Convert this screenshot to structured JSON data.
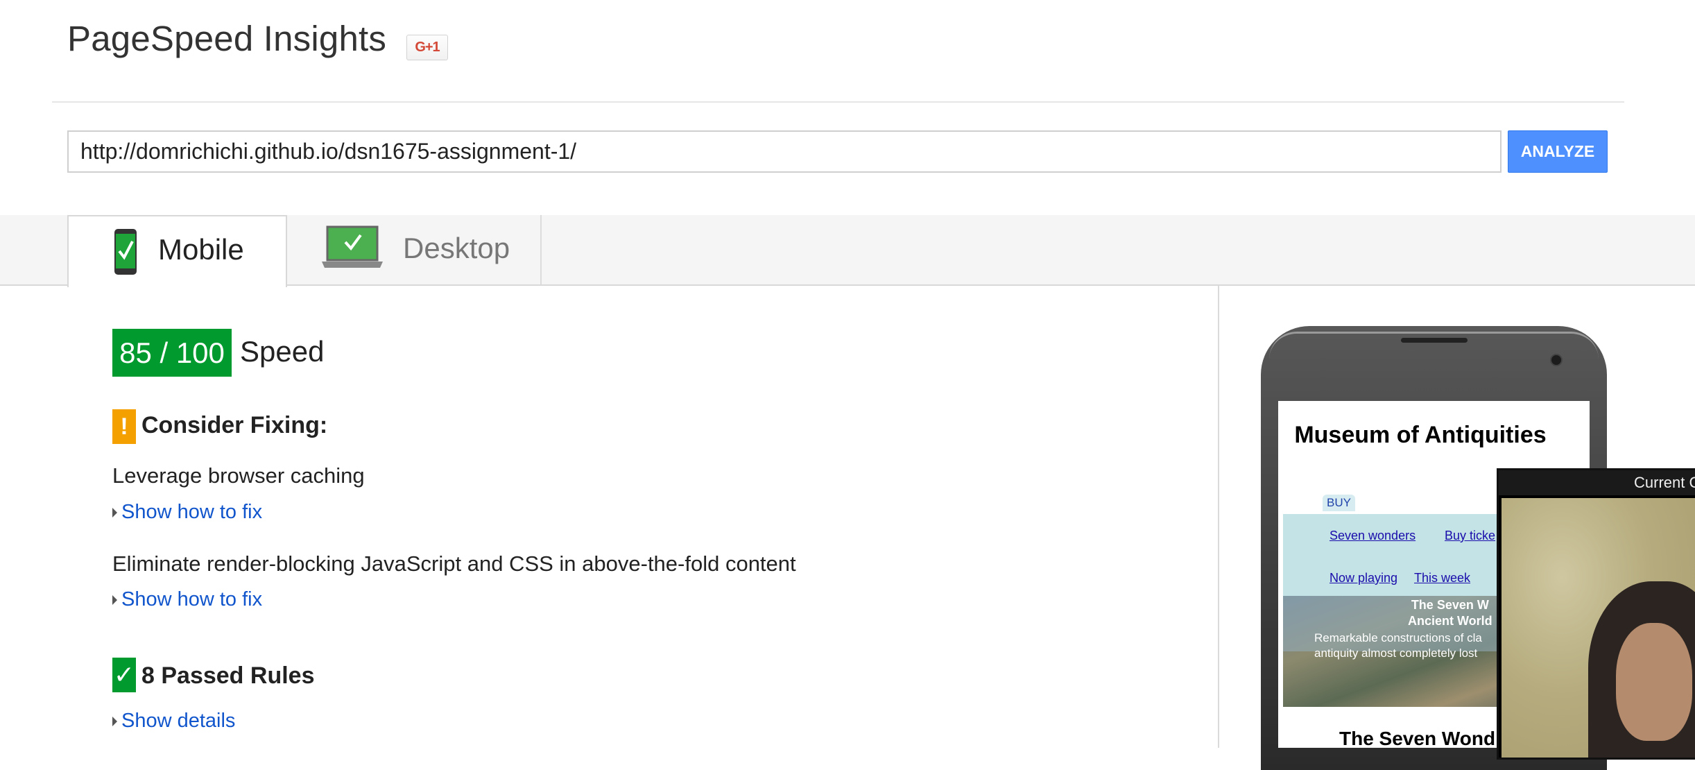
{
  "header": {
    "title": "PageSpeed Insights",
    "gplus_label": "G+1"
  },
  "search": {
    "url_value": "http://domrichichi.github.io/dsn1675-assignment-1/",
    "analyze_label": "ANALYZE"
  },
  "tabs": [
    {
      "label": "Mobile",
      "icon": "phone-check-icon",
      "active": true
    },
    {
      "label": "Desktop",
      "icon": "laptop-check-icon",
      "active": false
    }
  ],
  "score": {
    "value": "85 / 100",
    "label": "Speed",
    "color": "#009a2e"
  },
  "consider_fixing": {
    "heading": "Consider Fixing:",
    "icon": "warning-icon",
    "color": "#f4a100",
    "rules": [
      {
        "title": "Leverage browser caching",
        "link": "Show how to fix"
      },
      {
        "title": "Eliminate render-blocking JavaScript and CSS in above-the-fold content",
        "link": "Show how to fix"
      }
    ]
  },
  "passed": {
    "heading": "8 Passed Rules",
    "icon": "check-icon",
    "link": "Show details"
  },
  "preview": {
    "site_title": "Museum of Antiquities",
    "buy_tag": "BUY",
    "nav": [
      "Seven wonders",
      "Buy ticke",
      "Now playing",
      "This week"
    ],
    "hero_title": "The Seven W…\nAncient World",
    "hero_title_line1": "The Seven W",
    "hero_title_line2": "Ancient World",
    "hero_sub_line1": "Remarkable constructions of cla",
    "hero_sub_line2": "antiquity almost completely lost",
    "heading2": "The Seven Wond"
  },
  "webcam": {
    "title": "Current C"
  }
}
